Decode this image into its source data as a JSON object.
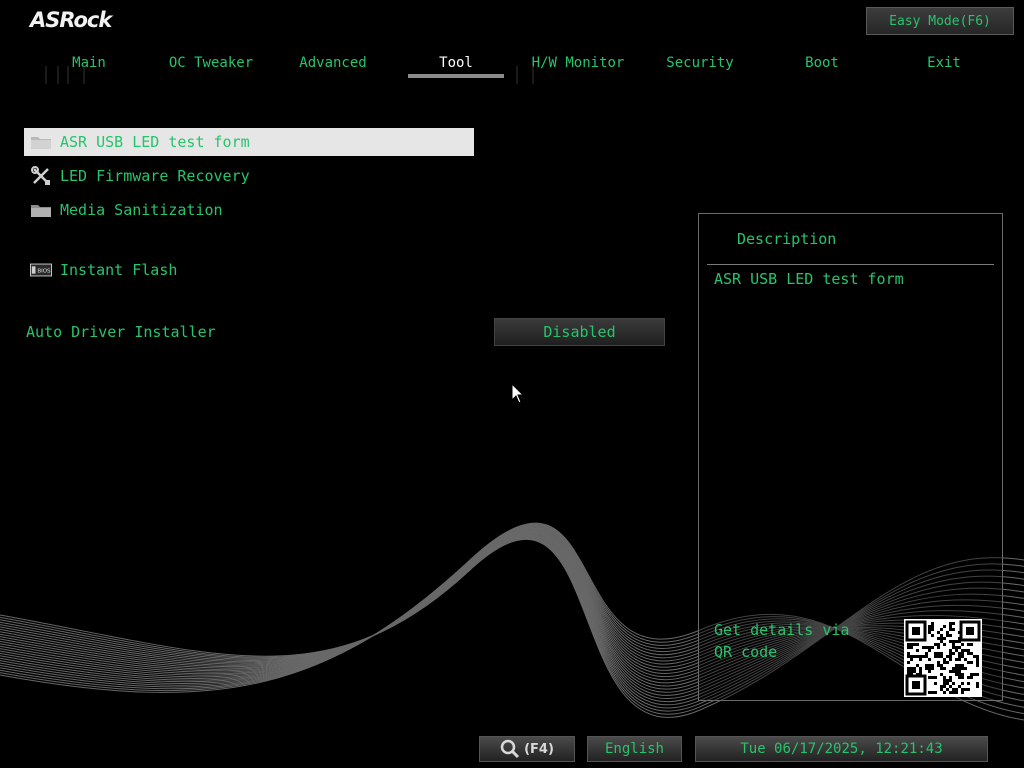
{
  "header": {
    "logo": "ASRock",
    "easy_mode_button": "Easy Mode(F6)"
  },
  "tabs": [
    {
      "label": "Main",
      "active": false
    },
    {
      "label": "OC Tweaker",
      "active": false
    },
    {
      "label": "Advanced",
      "active": false
    },
    {
      "label": "Tool",
      "active": true
    },
    {
      "label": "H/W Monitor",
      "active": false
    },
    {
      "label": "Security",
      "active": false
    },
    {
      "label": "Boot",
      "active": false
    },
    {
      "label": "Exit",
      "active": false
    }
  ],
  "menu": {
    "items": [
      {
        "label": "ASR USB LED test form",
        "icon": "folder-icon",
        "selected": true
      },
      {
        "label": "LED Firmware Recovery",
        "icon": "tools-icon",
        "selected": false
      },
      {
        "label": "Media Sanitization",
        "icon": "folder-icon",
        "selected": false
      },
      {
        "label": "Instant Flash",
        "icon": "bios-chip-icon",
        "selected": false
      }
    ],
    "bios_icon_text": "BIOS"
  },
  "option": {
    "label": "Auto Driver Installer",
    "value": "Disabled"
  },
  "description": {
    "title": "Description",
    "text": "ASR USB LED test form",
    "qr_text": "Get details via QR code"
  },
  "statusbar": {
    "search_label": "(F4)",
    "language": "English",
    "datetime": "Tue 06/17/2025, 12:21:43"
  },
  "colors": {
    "text_green": "#27c46b",
    "selected_bg": "#e6e6e6",
    "background": "#000000"
  }
}
